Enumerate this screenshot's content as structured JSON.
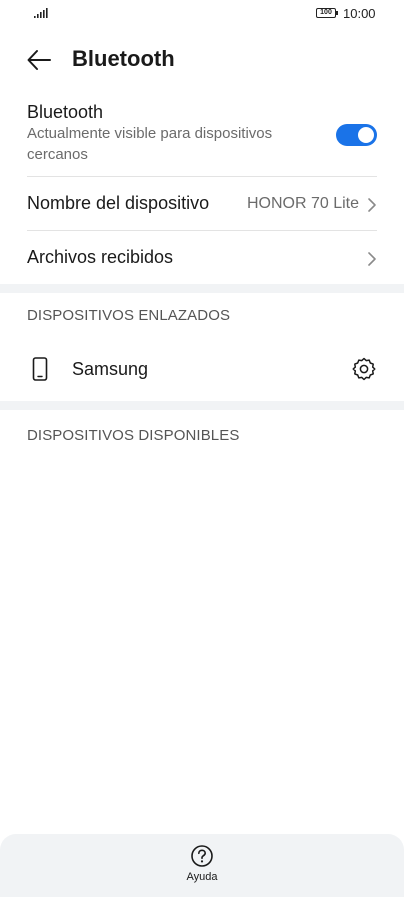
{
  "status_bar": {
    "battery": "100",
    "time": "10:00"
  },
  "header": {
    "title": "Bluetooth"
  },
  "bluetooth_row": {
    "title": "Bluetooth",
    "subtitle": "Actualmente visible para dispositivos cercanos",
    "enabled": true
  },
  "device_name_row": {
    "label": "Nombre del dispositivo",
    "value": "HONOR 70 Lite"
  },
  "received_files_row": {
    "label": "Archivos recibidos"
  },
  "paired_section": {
    "header": "DISPOSITIVOS ENLAZADOS",
    "devices": [
      {
        "name": "Samsung"
      }
    ]
  },
  "available_section": {
    "header": "DISPOSITIVOS DISPONIBLES"
  },
  "bottom_bar": {
    "help_label": "Ayuda"
  },
  "colors": {
    "accent": "#1a73e8",
    "secondary_text": "#6b6b6b",
    "section_gap": "#f1f3f5"
  }
}
